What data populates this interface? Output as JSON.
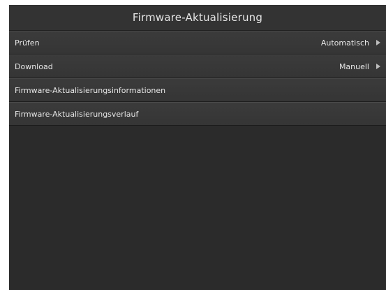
{
  "screen": {
    "title": "Firmware-Aktualisierung",
    "items": [
      {
        "label": "Prüfen",
        "value": "Automatisch",
        "has_arrow": true
      },
      {
        "label": "Download",
        "value": "Manuell",
        "has_arrow": true
      },
      {
        "label": "Firmware-Aktualisierungsinformationen"
      },
      {
        "label": "Firmware-Aktualisierungsverlauf"
      }
    ]
  },
  "colors": {
    "background": "#2d2d2d",
    "row": "#383838",
    "text": "#e6e6e6",
    "arrow": "#bdbdbd"
  }
}
